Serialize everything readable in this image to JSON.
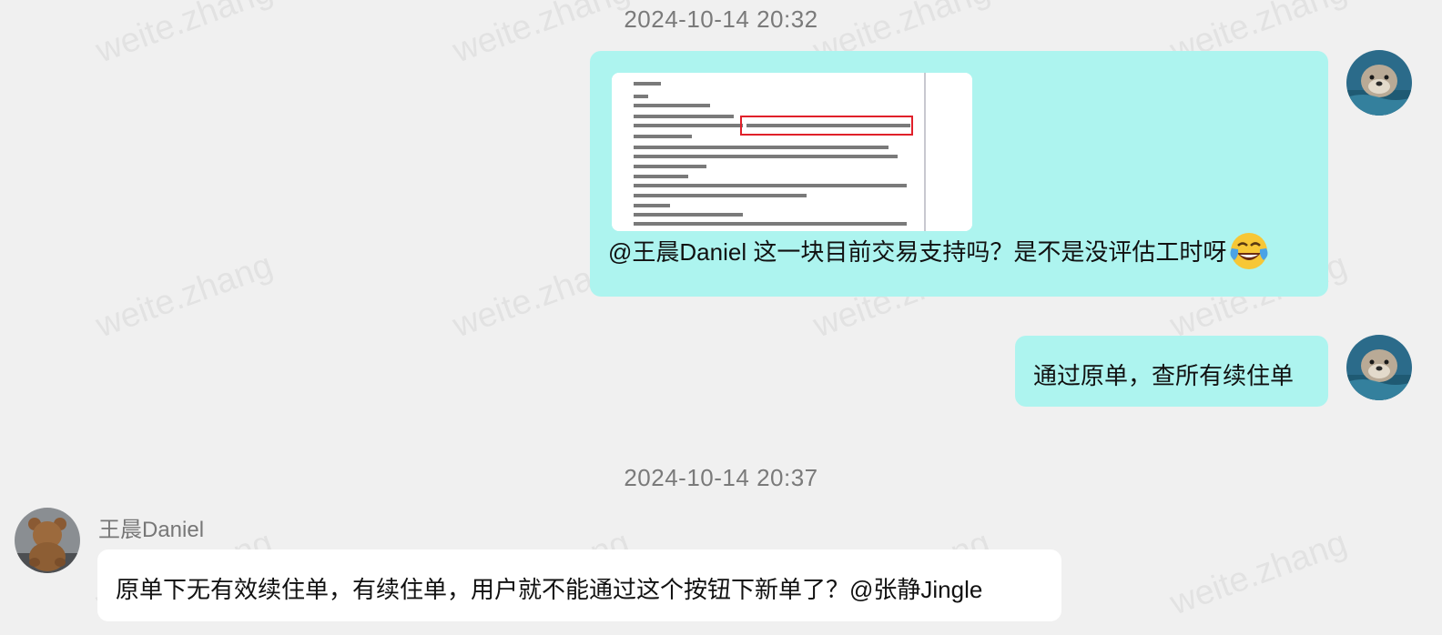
{
  "watermark_text": "weite.zhang",
  "messages": [
    {
      "timestamp": "2024-10-14 20:32",
      "outgoing": [
        {
          "has_image": true,
          "text": "@王晨Daniel 这一块目前交易支持吗？是不是没评估工时呀",
          "emoji": "face-with-tears-of-joy"
        },
        {
          "text": "通过原单，查所有续住单"
        }
      ]
    },
    {
      "timestamp": "2024-10-14 20:37",
      "incoming": {
        "sender": "王晨Daniel",
        "text": "原单下无有效续住单，有续住单，用户就不能通过这个按钮下新单了？@张静Jingle"
      }
    }
  ],
  "colors": {
    "background": "#f0f0f0",
    "outgoing_bubble": "#adf4ef",
    "incoming_bubble": "#ffffff",
    "highlight_box": "#e0202a"
  },
  "icons": {
    "self_avatar": "otter-avatar",
    "sender_avatar": "teddy-bear-avatar"
  }
}
